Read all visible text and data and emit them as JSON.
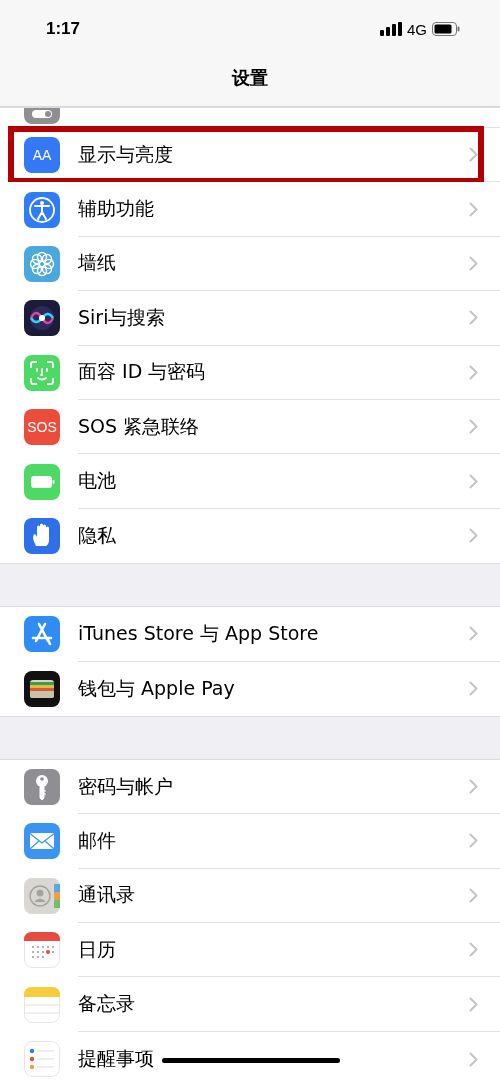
{
  "status_bar": {
    "time": "1:17",
    "network": "4G"
  },
  "nav": {
    "title": "设置"
  },
  "groups": [
    {
      "rows": [
        {
          "kind": "control",
          "clipped": true,
          "highlighted": false
        },
        {
          "kind": "display",
          "icon_text": "AA",
          "label": "显示与亮度",
          "clipped": false,
          "highlighted": true
        },
        {
          "kind": "accessibility",
          "label": "辅助功能",
          "clipped": false,
          "highlighted": false
        },
        {
          "kind": "wallpaper",
          "label": "墙纸",
          "clipped": false,
          "highlighted": false
        },
        {
          "kind": "siri",
          "label": "Siri与搜索",
          "clipped": false,
          "highlighted": false
        },
        {
          "kind": "faceid",
          "label": "面容 ID 与密码",
          "clipped": false,
          "highlighted": false
        },
        {
          "kind": "sos",
          "icon_text": "SOS",
          "label": "SOS 紧急联络",
          "clipped": false,
          "highlighted": false
        },
        {
          "kind": "battery",
          "label": "电池",
          "clipped": false,
          "highlighted": false
        },
        {
          "kind": "privacy",
          "label": "隐私",
          "clipped": false,
          "highlighted": false
        }
      ]
    },
    {
      "rows": [
        {
          "kind": "appstore",
          "label": "iTunes Store 与 App Store",
          "clipped": false,
          "highlighted": false
        },
        {
          "kind": "wallet",
          "label": "钱包与 Apple Pay",
          "clipped": false,
          "highlighted": false
        }
      ]
    },
    {
      "rows": [
        {
          "kind": "passwords",
          "label": "密码与帐户",
          "clipped": false,
          "highlighted": false
        },
        {
          "kind": "mail",
          "label": "邮件",
          "clipped": false,
          "highlighted": false
        },
        {
          "kind": "contacts",
          "label": "通讯录",
          "clipped": false,
          "highlighted": false
        },
        {
          "kind": "calendar",
          "label": "日历",
          "clipped": false,
          "highlighted": false
        },
        {
          "kind": "notes",
          "label": "备忘录",
          "clipped": false,
          "highlighted": false
        },
        {
          "kind": "reminders",
          "label": "提醒事项",
          "clipped": false,
          "highlighted": false
        }
      ]
    }
  ]
}
